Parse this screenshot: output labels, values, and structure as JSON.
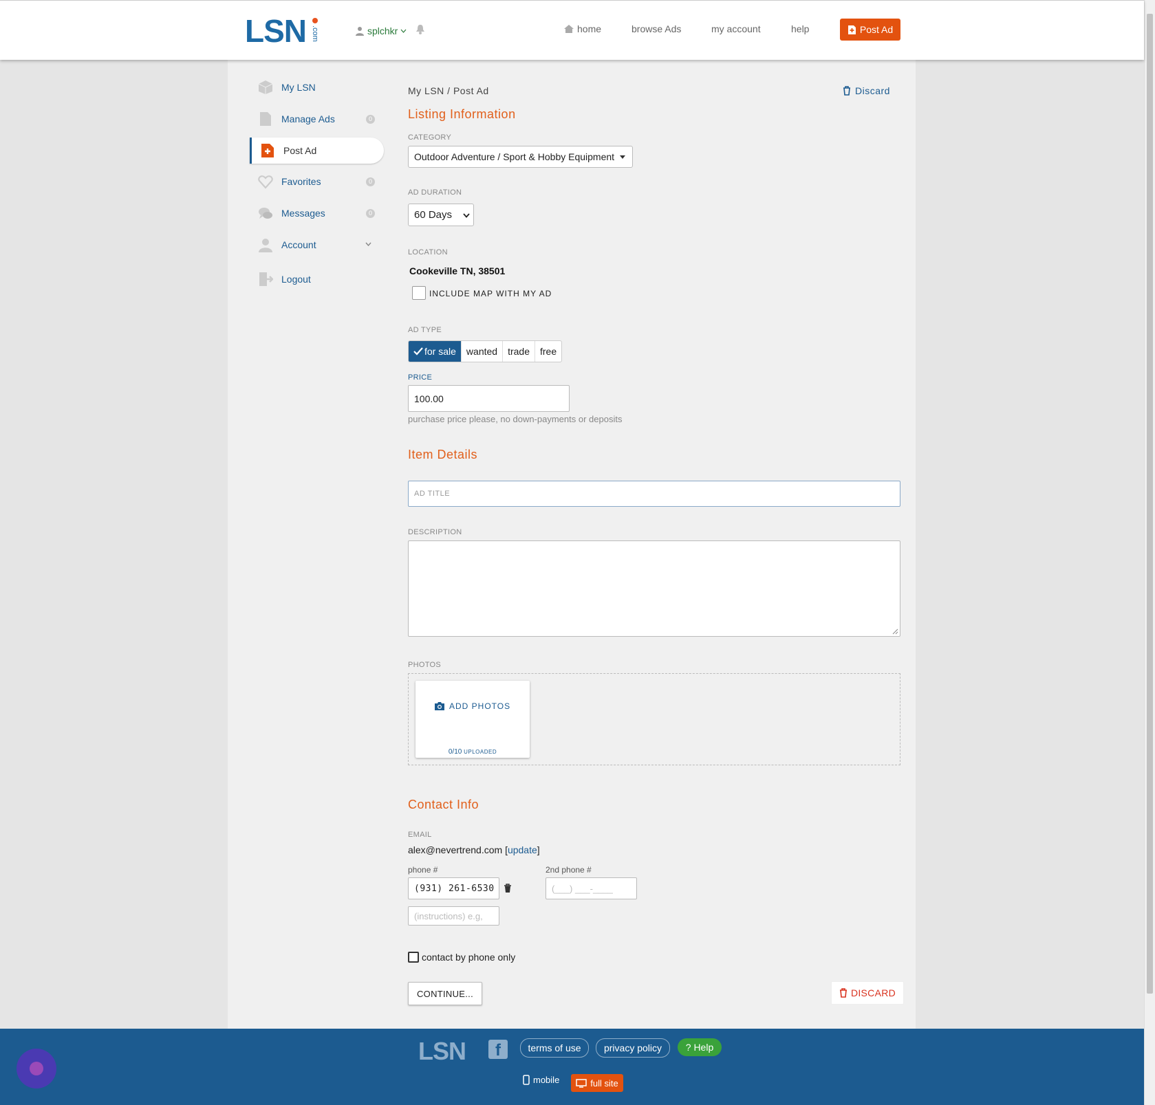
{
  "header": {
    "logo": "LSN",
    "logo_suffix": ".com",
    "username": "splchkr",
    "nav": {
      "home": "home",
      "browse": "browse Ads",
      "account": "my account",
      "help": "help"
    },
    "post_ad": "Post Ad"
  },
  "sidebar": {
    "items": [
      {
        "label": "My LSN",
        "icon": "box-icon"
      },
      {
        "label": "Manage Ads",
        "icon": "document-icon",
        "badge": "0"
      },
      {
        "label": "Post Ad",
        "icon": "post-ad-icon",
        "active": true
      },
      {
        "label": "Favorites",
        "icon": "heart-icon",
        "badge": "0"
      },
      {
        "label": "Messages",
        "icon": "chat-icon",
        "badge": "0"
      },
      {
        "label": "Account",
        "icon": "person-icon"
      },
      {
        "label": "Logout",
        "icon": "logout-icon"
      }
    ]
  },
  "breadcrumb": "My LSN / Post Ad",
  "discard_top": "Discard",
  "listing": {
    "heading": "Listing Information",
    "category_label": "CATEGORY",
    "category_value": "Outdoor Adventure / Sport & Hobby Equipment",
    "duration_label": "AD DURATION",
    "duration_value": "60 Days",
    "location_label": "LOCATION",
    "location_value": "Cookeville TN, 38501",
    "include_map": "INCLUDE MAP WITH MY AD",
    "adtype_label": "AD TYPE",
    "adtypes": [
      "for sale",
      "wanted",
      "trade",
      "free"
    ],
    "adtype_selected": "for sale",
    "price_label": "PRICE",
    "price_value": "100.00",
    "price_help": "purchase price please, no down-payments or deposits"
  },
  "details": {
    "heading": "Item Details",
    "title_placeholder": "AD TITLE",
    "description_label": "DESCRIPTION",
    "photos_label": "PHOTOS",
    "add_photos": "ADD PHOTOS",
    "uploaded_count": "0/10",
    "uploaded_label": "UPLOADED"
  },
  "contact": {
    "heading": "Contact Info",
    "email_label": "EMAIL",
    "email": "alex@nevertrend.com",
    "update_open": "[",
    "update": "update",
    "update_close": "]",
    "phone_label": "phone #",
    "phone_value": "(931) 261-6530",
    "phone2_label": "2nd phone #",
    "phone2_placeholder": "(___) ___-____",
    "instructions_placeholder": "(instructions) e.g,",
    "phone_only": "contact by phone only"
  },
  "actions": {
    "continue": "CONTINUE...",
    "discard": "DISCARD"
  },
  "footer": {
    "terms": "terms of use",
    "privacy": "privacy policy",
    "help": "? Help",
    "mobile": "mobile",
    "full_site": "full site"
  },
  "colors": {
    "brand_blue": "#1c5b90",
    "accent_orange": "#e3520f",
    "heading_orange": "#e1601c",
    "help_green": "#3aa23a",
    "discard_red": "#d9321f"
  }
}
